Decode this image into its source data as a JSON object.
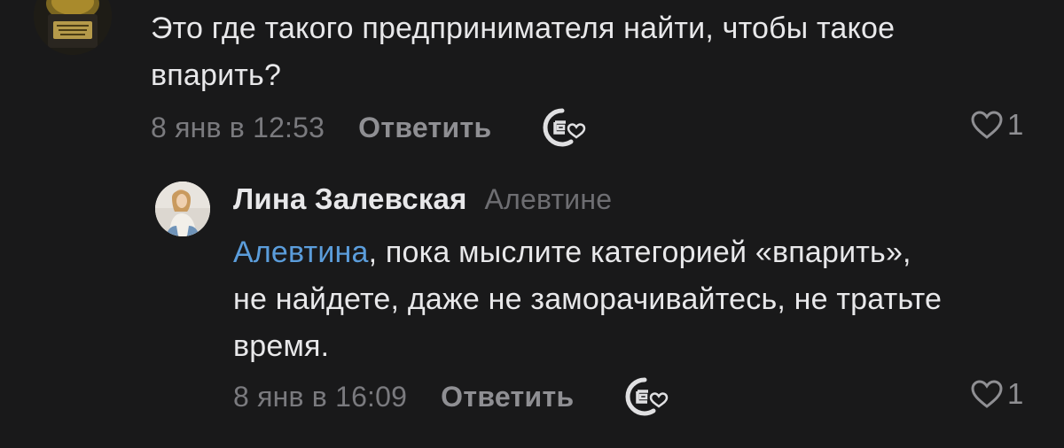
{
  "comments": [
    {
      "avatar_icon": "trophy-avatar",
      "text": "Это где такого предпринимателя найти, чтобы такое впарить?",
      "timestamp": "8 янв в 12:53",
      "reply_label": "Ответить",
      "sticker_icon": "sticker-reaction-icon",
      "like_icon": "heart-outline-icon",
      "likes": "1"
    }
  ],
  "reply": {
    "avatar_icon": "user-photo-avatar",
    "author": "Лина Залевская",
    "reply_to": "Алевтине",
    "mention": "Алевтина",
    "text_after_mention": ", пока мыслите категорией «впарить», не найдете, даже не заморачивайтесь, не тратьте время.",
    "timestamp": "8 янв в 16:09",
    "reply_label": "Ответить",
    "sticker_icon": "sticker-reaction-icon",
    "like_icon": "heart-outline-icon",
    "likes": "1"
  },
  "colors": {
    "background": "#19191a",
    "text": "#e8e8ea",
    "secondary": "#7a7a7e",
    "mention": "#5b9ddb"
  }
}
